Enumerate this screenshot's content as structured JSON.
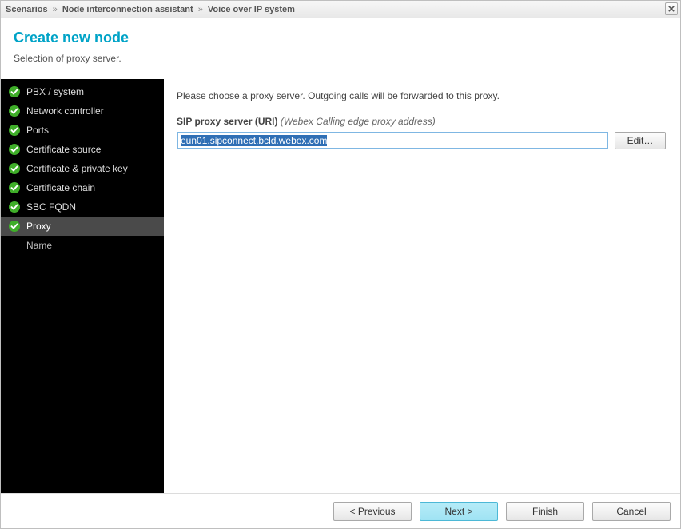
{
  "breadcrumb": [
    "Scenarios",
    "Node interconnection assistant",
    "Voice over IP system"
  ],
  "header": {
    "title": "Create new node",
    "subtitle": "Selection of proxy server."
  },
  "sidebar": {
    "items": [
      {
        "label": "PBX / system",
        "done": true,
        "active": false
      },
      {
        "label": "Network controller",
        "done": true,
        "active": false
      },
      {
        "label": "Ports",
        "done": true,
        "active": false
      },
      {
        "label": "Certificate source",
        "done": true,
        "active": false
      },
      {
        "label": "Certificate & private key",
        "done": true,
        "active": false
      },
      {
        "label": "Certificate chain",
        "done": true,
        "active": false
      },
      {
        "label": "SBC FQDN",
        "done": true,
        "active": false
      },
      {
        "label": "Proxy",
        "done": true,
        "active": true
      },
      {
        "label": "Name",
        "done": false,
        "active": false,
        "sub": true
      }
    ]
  },
  "main": {
    "instruction": "Please choose a proxy server. Outgoing calls will be forwarded to this proxy.",
    "field_label_bold": "SIP proxy server (URI)",
    "field_label_hint": "(Webex Calling edge proxy address)",
    "field_value": "eun01.sipconnect.bcld.webex.com",
    "edit_label": "Edit…"
  },
  "footer": {
    "previous": "< Previous",
    "next": "Next >",
    "finish": "Finish",
    "cancel": "Cancel"
  }
}
